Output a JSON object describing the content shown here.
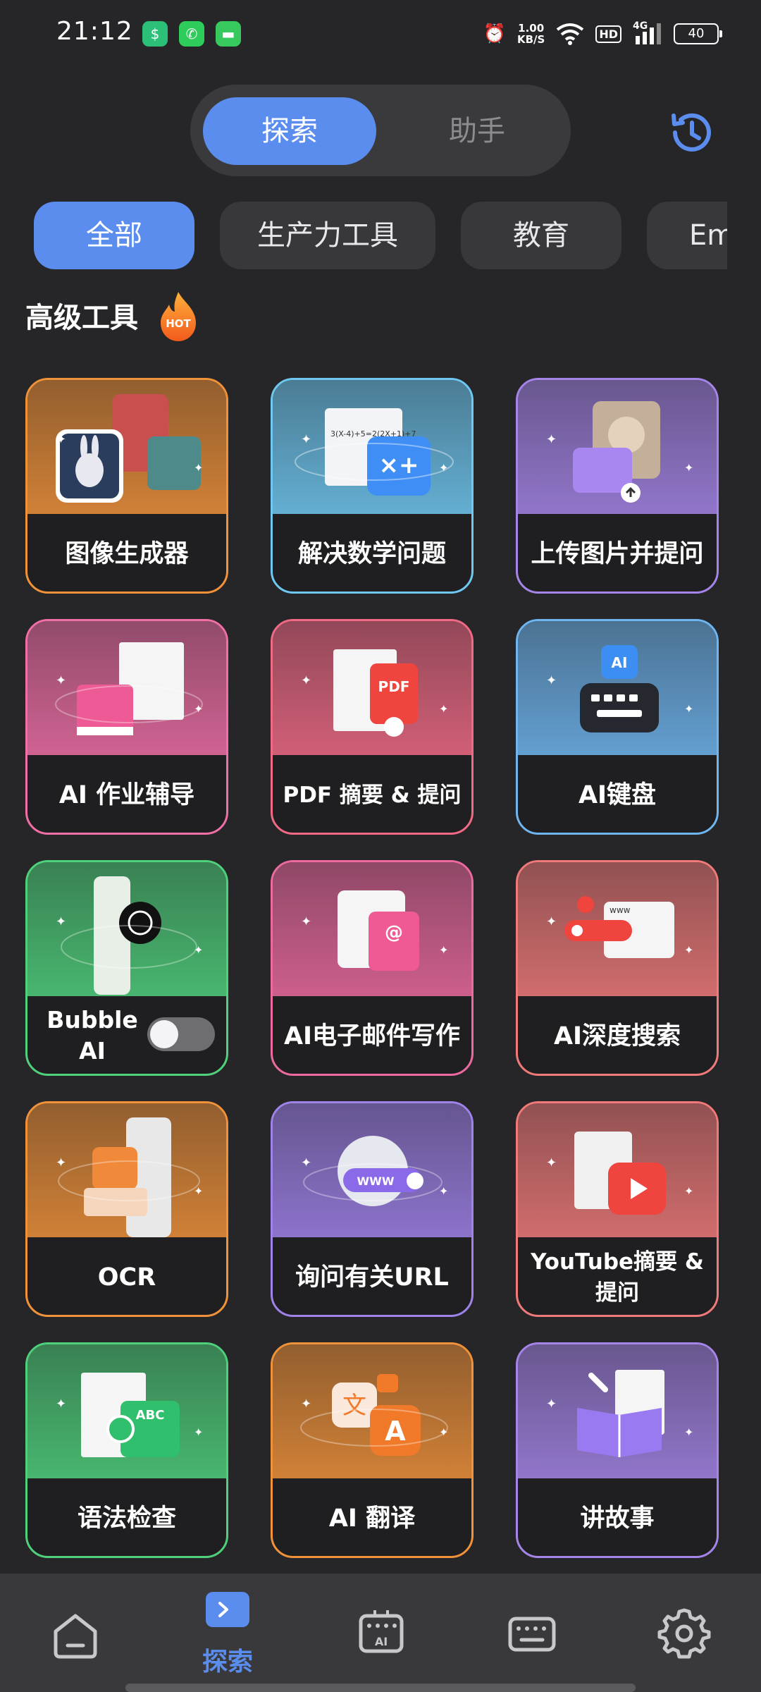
{
  "status_bar": {
    "time": "21:12",
    "net_speed_value": "1.00",
    "net_speed_unit": "KB/S",
    "hd_badge": "HD",
    "network_type": "4G",
    "battery": "40"
  },
  "mode_switch": {
    "tabs": [
      "探索",
      "助手"
    ],
    "active_index": 0
  },
  "categories": {
    "items": [
      "全部",
      "生产力工具",
      "教育",
      "Em"
    ],
    "active_index": 0
  },
  "section": {
    "title": "高级工具",
    "badge": "HOT"
  },
  "tools": [
    {
      "label": "图像生成器",
      "color": "#f0923a"
    },
    {
      "label": "解决数学问题",
      "color": "#6fc8f2"
    },
    {
      "label": "上传图片并提问",
      "color": "#a585e8"
    },
    {
      "label": "AI 作业辅导",
      "color": "#ef6fa6"
    },
    {
      "label": "PDF 摘要 & 提问",
      "color": "#f06a86"
    },
    {
      "label": "AI键盘",
      "color": "#6fb6f0"
    },
    {
      "label": "Bubble AI",
      "color": "#4fd17c",
      "toggle": false
    },
    {
      "label": "AI电子邮件写作",
      "color": "#ec6aa0"
    },
    {
      "label": "AI深度搜索",
      "color": "#f07a7a"
    },
    {
      "label": "OCR",
      "color": "#f0923a"
    },
    {
      "label": "询问有关URL",
      "color": "#9f82ea"
    },
    {
      "label": "YouTube摘要 & 提问",
      "color": "#f07a7a"
    },
    {
      "label": "语法检查",
      "color": "#4fd17c"
    },
    {
      "label": "AI 翻译",
      "color": "#f0923a"
    },
    {
      "label": "讲故事",
      "color": "#a585e8"
    }
  ],
  "bottom_nav": {
    "items": [
      "home-icon",
      "explore-icon",
      "ai-keyboard-icon",
      "keyboard-icon",
      "settings-icon"
    ],
    "active_label": "探索",
    "accent": "#5b8def"
  }
}
